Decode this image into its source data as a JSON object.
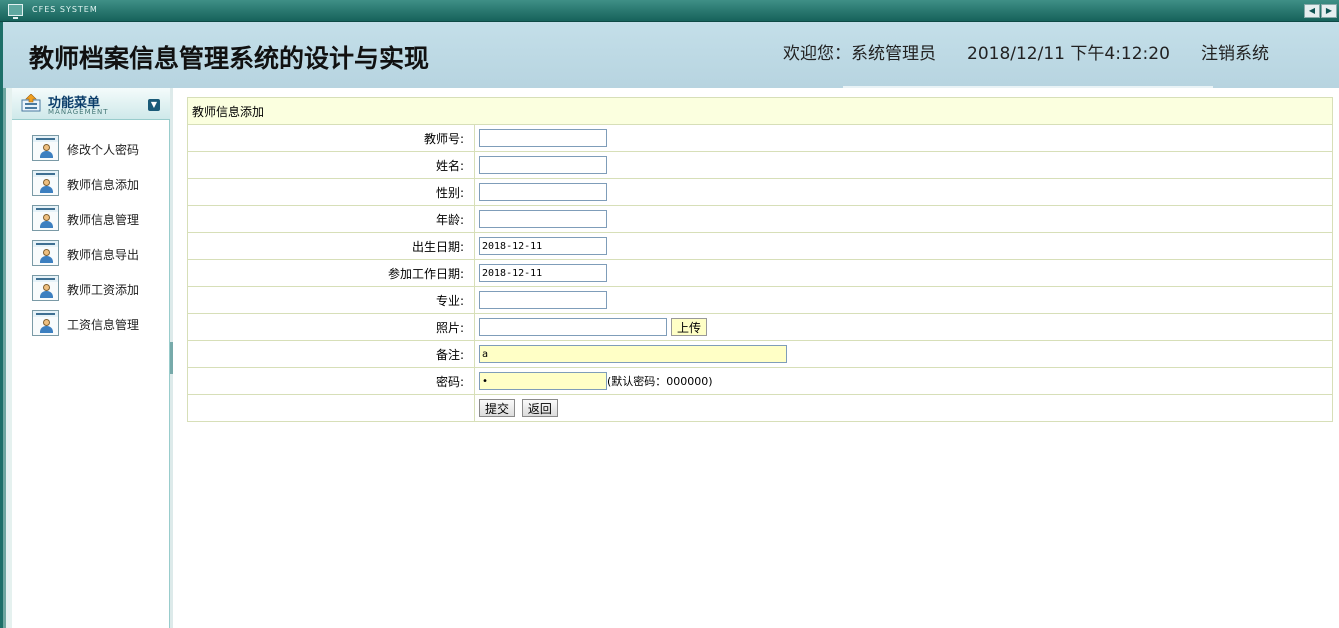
{
  "titlebar": {
    "system_text": "CFES SYSTEM"
  },
  "header": {
    "app_title": "教师档案信息管理系统的设计与实现",
    "welcome": "欢迎您：系统管理员",
    "datetime": "2018/12/11 下午4:12:20",
    "logout": "注销系统"
  },
  "sidebar": {
    "title": "功能菜单",
    "subtitle": "MANAGEMENT",
    "items": [
      {
        "label": "修改个人密码"
      },
      {
        "label": "教师信息添加"
      },
      {
        "label": "教师信息管理"
      },
      {
        "label": "教师信息导出"
      },
      {
        "label": "教师工资添加"
      },
      {
        "label": "工资信息管理"
      }
    ]
  },
  "form": {
    "caption": "教师信息添加",
    "fields": {
      "teacher_no": {
        "label": "教师号:",
        "value": ""
      },
      "name": {
        "label": "姓名:",
        "value": ""
      },
      "gender": {
        "label": "性别:",
        "value": ""
      },
      "age": {
        "label": "年龄:",
        "value": ""
      },
      "birth_date": {
        "label": "出生日期:",
        "value": "2018-12-11"
      },
      "work_start_date": {
        "label": "参加工作日期:",
        "value": "2018-12-11"
      },
      "major": {
        "label": "专业:",
        "value": ""
      },
      "photo": {
        "label": "照片:",
        "value": "",
        "upload_label": "上传"
      },
      "remark": {
        "label": "备注:",
        "value": "a"
      },
      "password": {
        "label": "密码:",
        "value": "•",
        "hint": "(默认密码：000000)"
      }
    },
    "submit_label": "提交",
    "back_label": "返回"
  }
}
